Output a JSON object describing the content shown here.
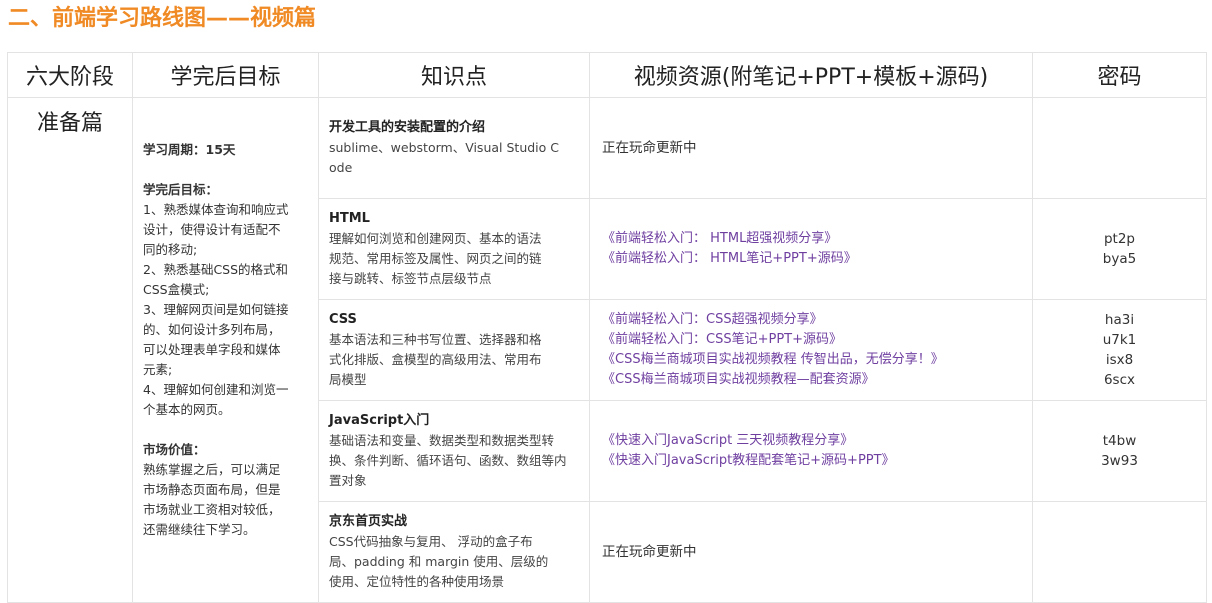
{
  "page_heading": "二、前端学习路线图——视频篇",
  "table": {
    "headers": [
      "六大阶段",
      "学完后目标",
      "知识点",
      "视频资源(附笔记+PPT+模板+源码)",
      "密码"
    ],
    "stage": "准备篇",
    "goals": {
      "period_label": "学习周期：15天",
      "goal_heading": "学完后目标：",
      "goal_lines": [
        "1、熟悉媒体查询和响应式",
        "设计，使得设计有适配不",
        "同的移动;",
        "2、熟悉基础CSS的格式和",
        "CSS盒模式;",
        "3、理解网页间是如何链接",
        "的、如何设计多列布局，",
        "可以处理表单字段和媒体",
        "元素;",
        "4、理解如何创建和浏览一",
        "个基本的网页。"
      ],
      "value_heading": "市场价值：",
      "value_lines": [
        "熟练掌握之后，可以满足",
        "市场静态页面布局，但是",
        "市场就业工资相对较低，",
        "还需继续往下学习。"
      ]
    },
    "rows": [
      {
        "topic_title": "开发工具的安装配置的介绍",
        "topic_lines": [
          "sublime、webstorm、Visual Studio C",
          "ode"
        ],
        "resource_status": "正在玩命更新中",
        "links": [],
        "passwords": []
      },
      {
        "topic_title": "HTML",
        "topic_lines": [
          "理解如何浏览和创建网页、基本的语法",
          "规范、常用标签及属性、网页之间的链",
          "接与跳转、标签节点层级节点"
        ],
        "resource_status": "",
        "links": [
          "《前端轻松入门： HTML超强视频分享》",
          "《前端轻松入门： HTML笔记+PPT+源码》"
        ],
        "passwords": [
          "pt2p",
          "bya5"
        ]
      },
      {
        "topic_title": "CSS",
        "topic_lines": [
          "基本语法和三种书写位置、选择器和格",
          "式化排版、盒模型的高级用法、常用布",
          "局模型"
        ],
        "resource_status": "",
        "links": [
          "《前端轻松入门：CSS超强视频分享》",
          "《前端轻松入门：CSS笔记+PPT+源码》",
          "《CSS梅兰商城项目实战视频教程 传智出品，无偿分享！》",
          "《CSS梅兰商城项目实战视频教程—配套资源》"
        ],
        "passwords": [
          "ha3i",
          "u7k1",
          "isx8",
          "6scx"
        ]
      },
      {
        "topic_title": "JavaScript入门",
        "topic_lines": [
          "基础语法和变量、数据类型和数据类型转",
          "换、条件判断、循环语句、函数、数组等内",
          "置对象"
        ],
        "resource_status": "",
        "links": [
          "《快速入门JavaScript 三天视频教程分享》",
          "《快速入门JavaScript教程配套笔记+源码+PPT》"
        ],
        "passwords": [
          "t4bw",
          "3w93"
        ]
      },
      {
        "topic_title": "京东首页实战",
        "topic_lines": [
          " CSS代码抽象与复用、 浮动的盒子布",
          "局、padding 和 margin 使用、层级的",
          "使用、定位特性的各种使用场景"
        ],
        "resource_status": "正在玩命更新中",
        "links": [],
        "passwords": []
      }
    ]
  }
}
